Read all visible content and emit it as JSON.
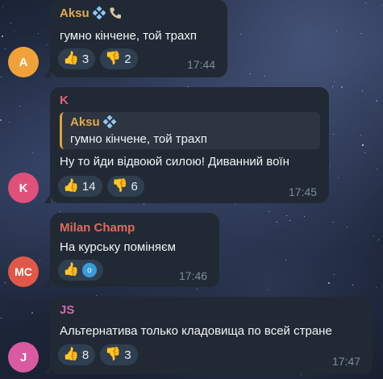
{
  "colors": {
    "bubble_bg": "#212a34",
    "aksu_name": "#e5a94a",
    "k_name": "#e0607a",
    "milan_name": "#e06a5c",
    "js_name": "#d06aa8",
    "avatar_aksu": "#f0a13a",
    "avatar_k": "#e0507a",
    "avatar_mc": "#e05848",
    "avatar_j": "#d95aa0"
  },
  "messages": [
    {
      "avatar": "A",
      "sender": "Aksu",
      "sender_icons": [
        "verified-diamond-icon",
        "phone-icon"
      ],
      "text": "гумно кінчене, той трахп",
      "reactions": [
        {
          "emoji": "👍",
          "count": "3"
        },
        {
          "emoji": "👎",
          "count": "2"
        }
      ],
      "time": "17:44"
    },
    {
      "avatar": "K",
      "sender": "K",
      "reply": {
        "sender": "Aksu",
        "text": "гумно кінчене, той трахп"
      },
      "text": "Ну то йди відвоюй силою! Диванний воїн",
      "reactions": [
        {
          "emoji": "👍",
          "count": "14"
        },
        {
          "emoji": "👎",
          "count": "6"
        }
      ],
      "time": "17:45"
    },
    {
      "avatar": "MC",
      "sender": "Milan Champ",
      "text": "На курську поміняєм",
      "reactions": [
        {
          "emoji": "👍",
          "badge": "o"
        }
      ],
      "time": "17:46"
    },
    {
      "avatar": "J",
      "sender": "JS",
      "text": "Альтернатива только кладовища по всей стране",
      "reactions": [
        {
          "emoji": "👍",
          "count": "8"
        },
        {
          "emoji": "👎",
          "count": "3"
        }
      ],
      "time": "17:47"
    }
  ]
}
